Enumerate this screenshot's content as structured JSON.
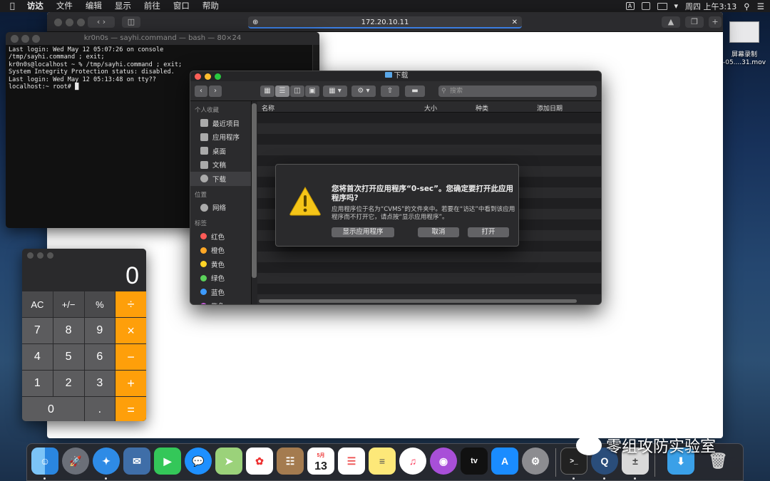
{
  "menubar": {
    "items": [
      "访达",
      "文件",
      "编辑",
      "显示",
      "前往",
      "窗口",
      "帮助"
    ],
    "input_source": "A",
    "clock": "周四 上午3:13"
  },
  "browser": {
    "url": "172.20.10.11"
  },
  "desktop_item": {
    "label": "屏幕录制\n-05....31.mov"
  },
  "terminal": {
    "title": "kr0n0s — sayhi.command — bash — 80×24",
    "lines": [
      "Last login: Wed May 12 05:07:26 on console",
      "/tmp/sayhi.command ; exit;",
      "kr0n0s@localhost ~ % /tmp/sayhi.command ; exit;",
      "System Integrity Protection status: disabled.",
      "Last login: Wed May 12 05:13:48 on tty??",
      "localhost:~ root# █"
    ]
  },
  "finder": {
    "title": "下载",
    "search_placeholder": "搜索",
    "sidebar": {
      "favorites_header": "个人收藏",
      "favorites": [
        "最近项目",
        "应用程序",
        "桌面",
        "文稿",
        "下载"
      ],
      "locations_header": "位置",
      "locations": [
        "网络"
      ],
      "tags_header": "标签",
      "tags": [
        {
          "name": "红色",
          "color": "#ff5b57"
        },
        {
          "name": "橙色",
          "color": "#ffa726"
        },
        {
          "name": "黄色",
          "color": "#ffd426"
        },
        {
          "name": "绿色",
          "color": "#5bd25a"
        },
        {
          "name": "蓝色",
          "color": "#3d9bff"
        },
        {
          "name": "紫色",
          "color": "#c45ad8"
        }
      ]
    },
    "columns": [
      "名称",
      "大小",
      "种类",
      "添加日期"
    ]
  },
  "dialog": {
    "title": "您将首次打开应用程序“0-sec”。您确定要打开此应用程序吗?",
    "message": "应用程序位于名为“CVMS”的文件夹中。若要在“访达”中看到该应用程序而不打开它，请点按“显示应用程序”。",
    "show_app": "显示应用程序",
    "cancel": "取消",
    "open": "打开"
  },
  "calculator": {
    "display": "0",
    "keys": [
      "AC",
      "+/−",
      "%",
      "÷",
      "7",
      "8",
      "9",
      "×",
      "4",
      "5",
      "6",
      "−",
      "1",
      "2",
      "3",
      "+",
      "0",
      ".",
      "="
    ]
  },
  "dock": {
    "calendar_month": "5月",
    "calendar_day": "13",
    "tv_label": "tv"
  },
  "watermark": "零组攻防实验室"
}
